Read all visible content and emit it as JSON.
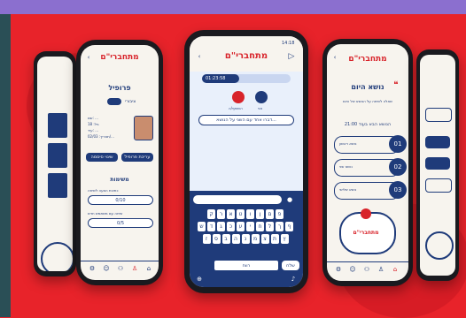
{
  "colors": {
    "brand_red": "#d8232a",
    "navy": "#1f3b7a",
    "cream": "#f7f4ee",
    "background": "#e8232a",
    "top_band": "#8b6fcf"
  },
  "app": {
    "logo": "מתחברי\"ם",
    "time": "14:18"
  },
  "profile": {
    "title": "פרופיל",
    "toggle_label": "ציבורי",
    "info_lines": [
      "שם: ...",
      "גיל: 18",
      "עיר: ...",
      "תאריך: 02/03/..."
    ],
    "button_edit": "עריכת פרופיל",
    "button_other": "שינוי סיסמה",
    "tasks_title": "משימות",
    "task_1": "כתיבת הצעה לשיחה",
    "task_1_value": "0/10",
    "task_2": "שיחה עם משתמש חדש",
    "task_2_value": "0/5"
  },
  "chat": {
    "timer": "01:23:58",
    "user_right": "אני",
    "user_left": "השותף/ה",
    "prompt": "דברו אחד עם השני על הנושא...",
    "send_button": "שלח",
    "keyboard_rows": [
      [
        "ק",
        "ר",
        "א",
        "ט",
        "ו",
        "ן",
        "ם",
        "פ"
      ],
      [
        "ש",
        "ד",
        "ג",
        "כ",
        "ע",
        "י",
        "ח",
        "ל",
        "ך",
        "ף"
      ],
      [
        "ז",
        "ס",
        "ב",
        "ה",
        "נ",
        "מ",
        "צ",
        "ת",
        "ץ"
      ]
    ],
    "space_label": "רווח"
  },
  "topic": {
    "title": "נושא היום",
    "description": "שאלה לשיחה על הנושא של היום",
    "next_label": "הנושא הבא בעוד 21:00",
    "items": [
      {
        "num": "01",
        "text": "נושא ראשון"
      },
      {
        "num": "02",
        "text": "נושא שני"
      },
      {
        "num": "03",
        "text": "נושא שלישי"
      }
    ],
    "badge": "מתחברי\"ם"
  }
}
